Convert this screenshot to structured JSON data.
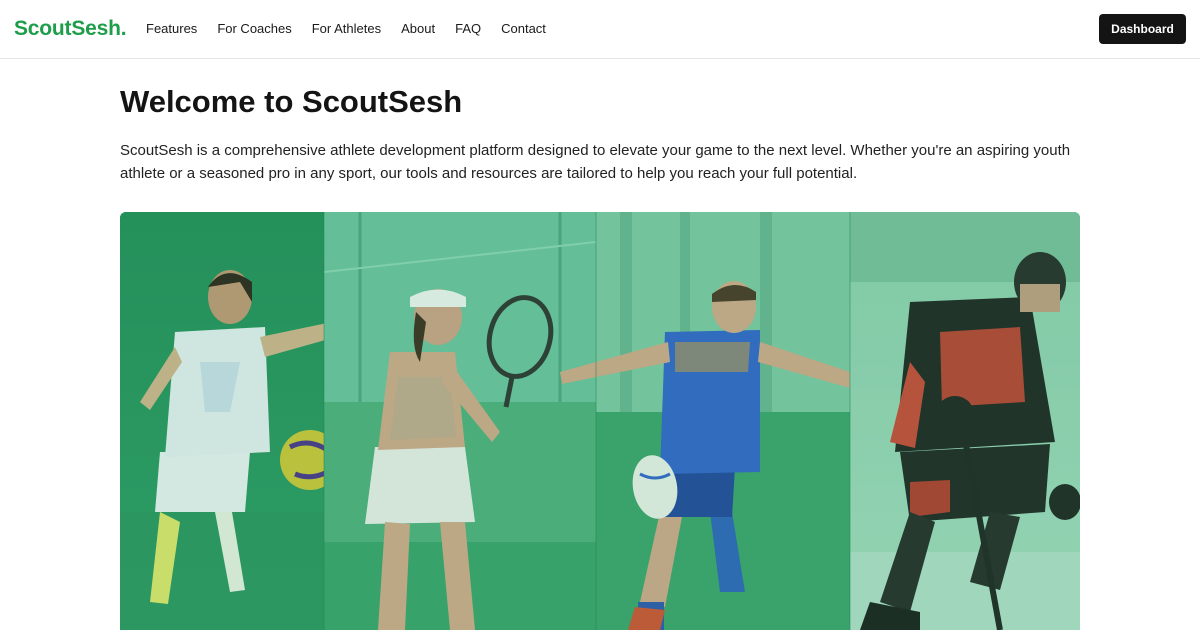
{
  "header": {
    "logo": "ScoutSesh.",
    "nav": [
      {
        "label": "Features"
      },
      {
        "label": "For Coaches"
      },
      {
        "label": "For Athletes"
      },
      {
        "label": "About"
      },
      {
        "label": "FAQ"
      },
      {
        "label": "Contact"
      }
    ],
    "dashboard_label": "Dashboard"
  },
  "main": {
    "title": "Welcome to ScoutSesh",
    "intro": "ScoutSesh is a comprehensive athlete development platform designed to elevate your game to the next level. Whether you're an aspiring youth athlete or a seasoned pro in any sport, our tools and resources are tailored to help you reach your full potential."
  },
  "hero": {
    "panels": [
      {
        "sport": "soccer",
        "icon": "soccer-player-photo"
      },
      {
        "sport": "tennis",
        "icon": "tennis-player-photo"
      },
      {
        "sport": "rugby",
        "icon": "rugby-player-photo"
      },
      {
        "sport": "hockey",
        "icon": "hockey-player-photo"
      }
    ],
    "colors": {
      "tint": "#3fae72",
      "brand": "#1e9e4a"
    }
  }
}
